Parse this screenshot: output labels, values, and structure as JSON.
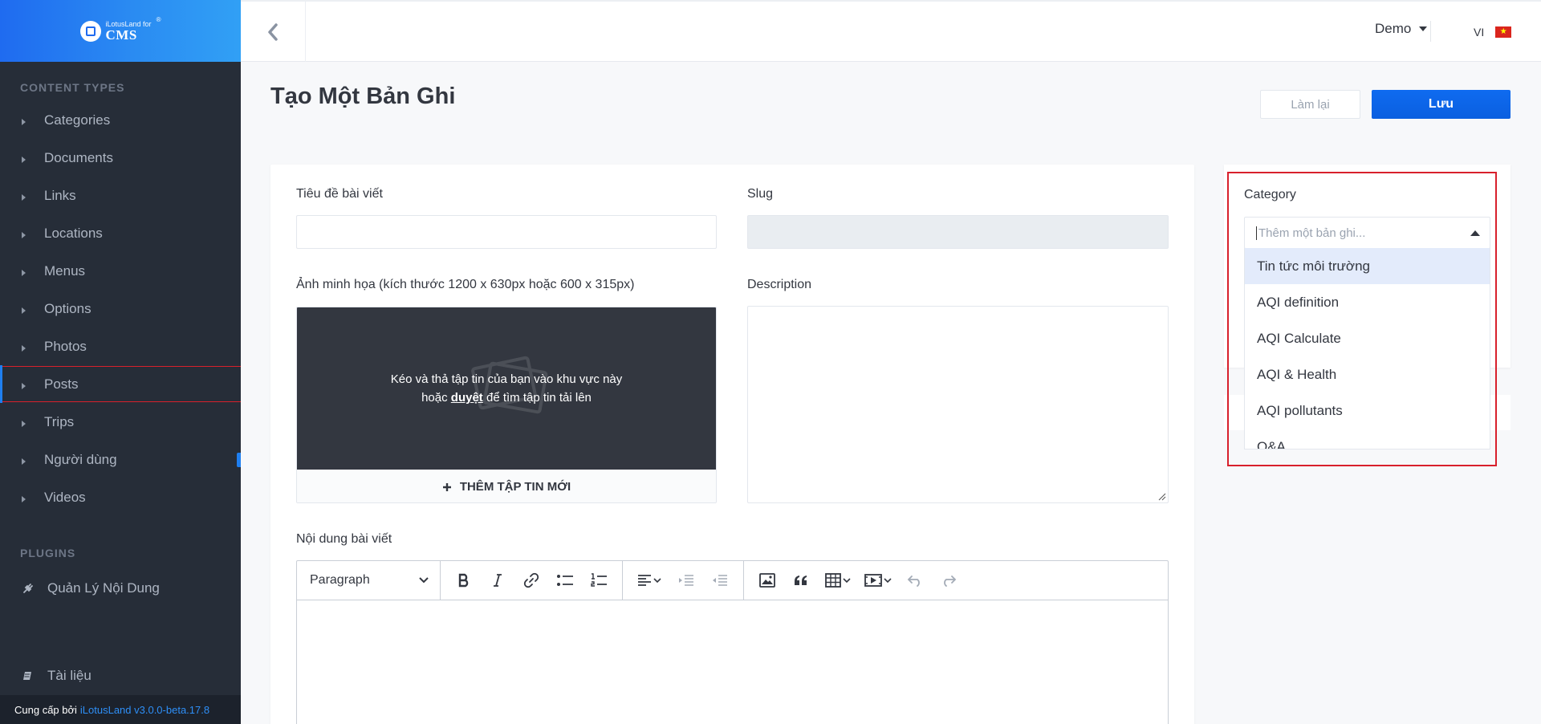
{
  "brand": {
    "small": "iLotusLand for",
    "big": "CMS",
    "reg": "®"
  },
  "sidebar": {
    "content_types_title": "CONTENT TYPES",
    "items": [
      {
        "label": "Categories"
      },
      {
        "label": "Documents"
      },
      {
        "label": "Links"
      },
      {
        "label": "Locations"
      },
      {
        "label": "Menus"
      },
      {
        "label": "Options"
      },
      {
        "label": "Photos"
      },
      {
        "label": "Posts"
      },
      {
        "label": "Trips"
      },
      {
        "label": "Người dùng"
      },
      {
        "label": "Videos"
      }
    ],
    "plugins_title": "PLUGINS",
    "plugins": [
      {
        "label": "Quản Lý Nội Dung"
      }
    ],
    "docs": {
      "label": "Tài liệu"
    },
    "footer": {
      "prefix": "Cung cấp bởi",
      "version": "iLotusLand v3.0.0-beta.17.8"
    }
  },
  "topbar": {
    "user": "Demo",
    "lang": "VI",
    "flag_star": "★"
  },
  "header": {
    "title": "Tạo Một Bản Ghi",
    "reset_label": "Làm lại",
    "save_label": "Lưu"
  },
  "form": {
    "title_label": "Tiêu đề bài viết",
    "slug_label": "Slug",
    "image_label": "Ảnh minh họa (kích thước 1200 x 630px hoặc 600 x 315px)",
    "dropzone_line1": "Kéo và thả tập tin của bạn vào khu vực này",
    "dropzone_line2_pre": "hoặc",
    "dropzone_link": "duyệt",
    "dropzone_line2_post": "để tìm tập tin tải lên",
    "add_file_label": "THÊM TẬP TIN MỚI",
    "description_label": "Description",
    "content_label": "Nội dung bài viết",
    "editor_heading": "Paragraph"
  },
  "category": {
    "label": "Category",
    "placeholder": "Thêm một bản ghi...",
    "options": [
      "Tin tức môi trường",
      "AQI definition",
      "AQI Calculate",
      "AQI & Health",
      "AQI pollutants",
      "Q&A"
    ]
  },
  "colors": {
    "accent": "#0f6bf0",
    "sidebar_bg": "#262d38",
    "highlight": "#d8202c"
  }
}
